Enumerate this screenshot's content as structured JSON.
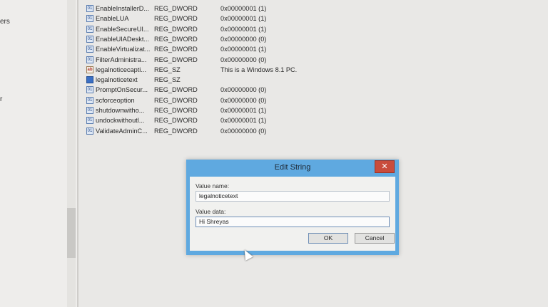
{
  "tree": {
    "fragments": [
      "ers",
      "r"
    ]
  },
  "values": [
    {
      "name": "EnableInstallerD...",
      "type": "REG_DWORD",
      "data": "0x00000001 (1)",
      "kind": "dword"
    },
    {
      "name": "EnableLUA",
      "type": "REG_DWORD",
      "data": "0x00000001 (1)",
      "kind": "dword"
    },
    {
      "name": "EnableSecureUI...",
      "type": "REG_DWORD",
      "data": "0x00000001 (1)",
      "kind": "dword"
    },
    {
      "name": "EnableUIADeskt...",
      "type": "REG_DWORD",
      "data": "0x00000000 (0)",
      "kind": "dword"
    },
    {
      "name": "EnableVirtualizat...",
      "type": "REG_DWORD",
      "data": "0x00000001 (1)",
      "kind": "dword"
    },
    {
      "name": "FilterAdministra...",
      "type": "REG_DWORD",
      "data": "0x00000000 (0)",
      "kind": "dword"
    },
    {
      "name": "legalnoticecapti...",
      "type": "REG_SZ",
      "data": "This is a Windows 8.1 PC.",
      "kind": "sz"
    },
    {
      "name": "legalnoticetext",
      "type": "REG_SZ",
      "data": "",
      "kind": "sz-selected"
    },
    {
      "name": "PromptOnSecur...",
      "type": "REG_DWORD",
      "data": "0x00000000 (0)",
      "kind": "dword"
    },
    {
      "name": "scforceoption",
      "type": "REG_DWORD",
      "data": "0x00000000 (0)",
      "kind": "dword"
    },
    {
      "name": "shutdownwitho...",
      "type": "REG_DWORD",
      "data": "0x00000001 (1)",
      "kind": "dword"
    },
    {
      "name": "undockwithoutl...",
      "type": "REG_DWORD",
      "data": "0x00000001 (1)",
      "kind": "dword"
    },
    {
      "name": "ValidateAdminC...",
      "type": "REG_DWORD",
      "data": "0x00000000 (0)",
      "kind": "dword"
    }
  ],
  "dialog": {
    "title": "Edit String",
    "close_glyph": "✕",
    "value_name_label": "Value name:",
    "value_name": "legalnoticetext",
    "value_data_label": "Value data:",
    "value_data": "Hi Shreyas",
    "ok_label": "OK",
    "cancel_label": "Cancel"
  },
  "icons": {
    "dword": "binary-value-icon",
    "sz": "string-value-icon",
    "cursor": "mouse-cursor-icon"
  }
}
